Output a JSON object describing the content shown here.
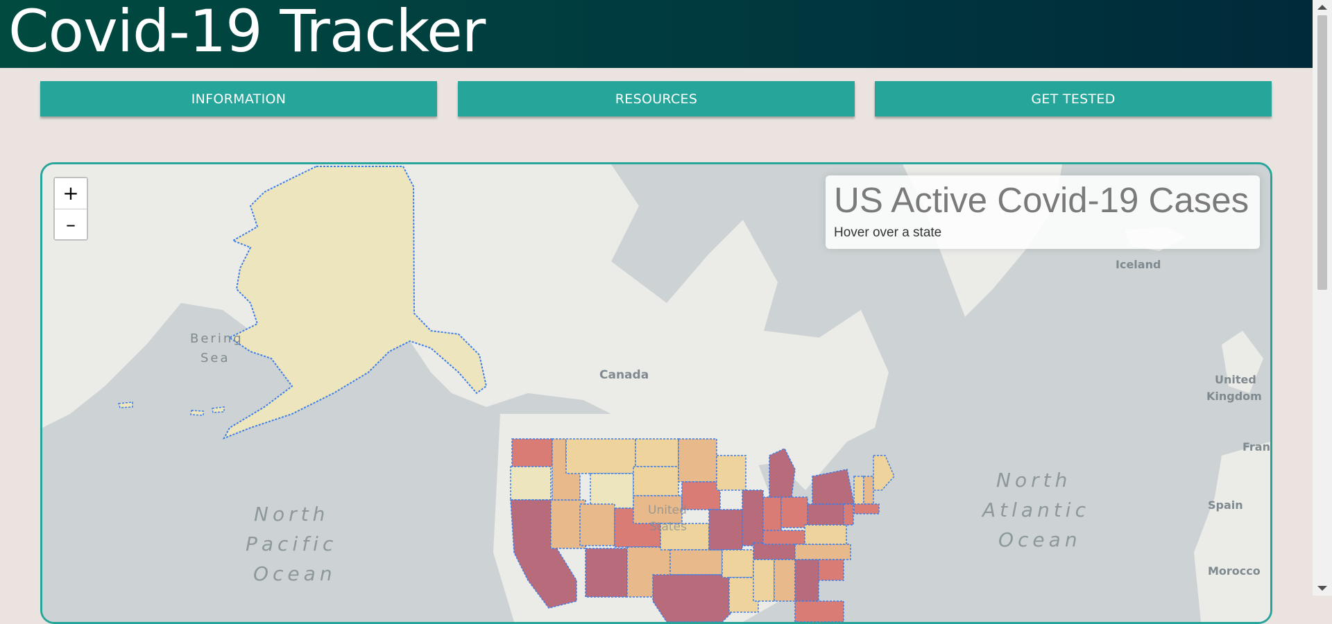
{
  "header": {
    "title": "Covid-19 Tracker"
  },
  "nav": {
    "information": "INFORMATION",
    "resources": "RESOURCES",
    "get_tested": "GET TESTED"
  },
  "map": {
    "zoom_in": "+",
    "zoom_out": "–",
    "info_title": "US Active Covid-19 Cases",
    "info_hint": "Hover over a state",
    "labels": {
      "bering_1": "Bering",
      "bering_2": "Sea",
      "canada": "Canada",
      "iceland": "Iceland",
      "uk_1": "United",
      "uk_2": "Kingdom",
      "france": "Fran",
      "spain": "Spain",
      "morocco": "Morocco",
      "us_1": "United",
      "us_2": "States",
      "north_pacific": [
        "North",
        "Pacific",
        "Ocean"
      ],
      "north_atlantic": [
        "North",
        "Atlantic",
        "Ocean"
      ]
    }
  },
  "colors": {
    "header_start": "#004a3f",
    "header_end": "#002a3a",
    "accent": "#26a69a",
    "page_bg": "#ebe3df",
    "water": "#cdd3d4",
    "land": "#ebebe8",
    "state_low": "#ede5bd",
    "state_mid": "#e8b98a",
    "state_high": "#c06a79"
  }
}
